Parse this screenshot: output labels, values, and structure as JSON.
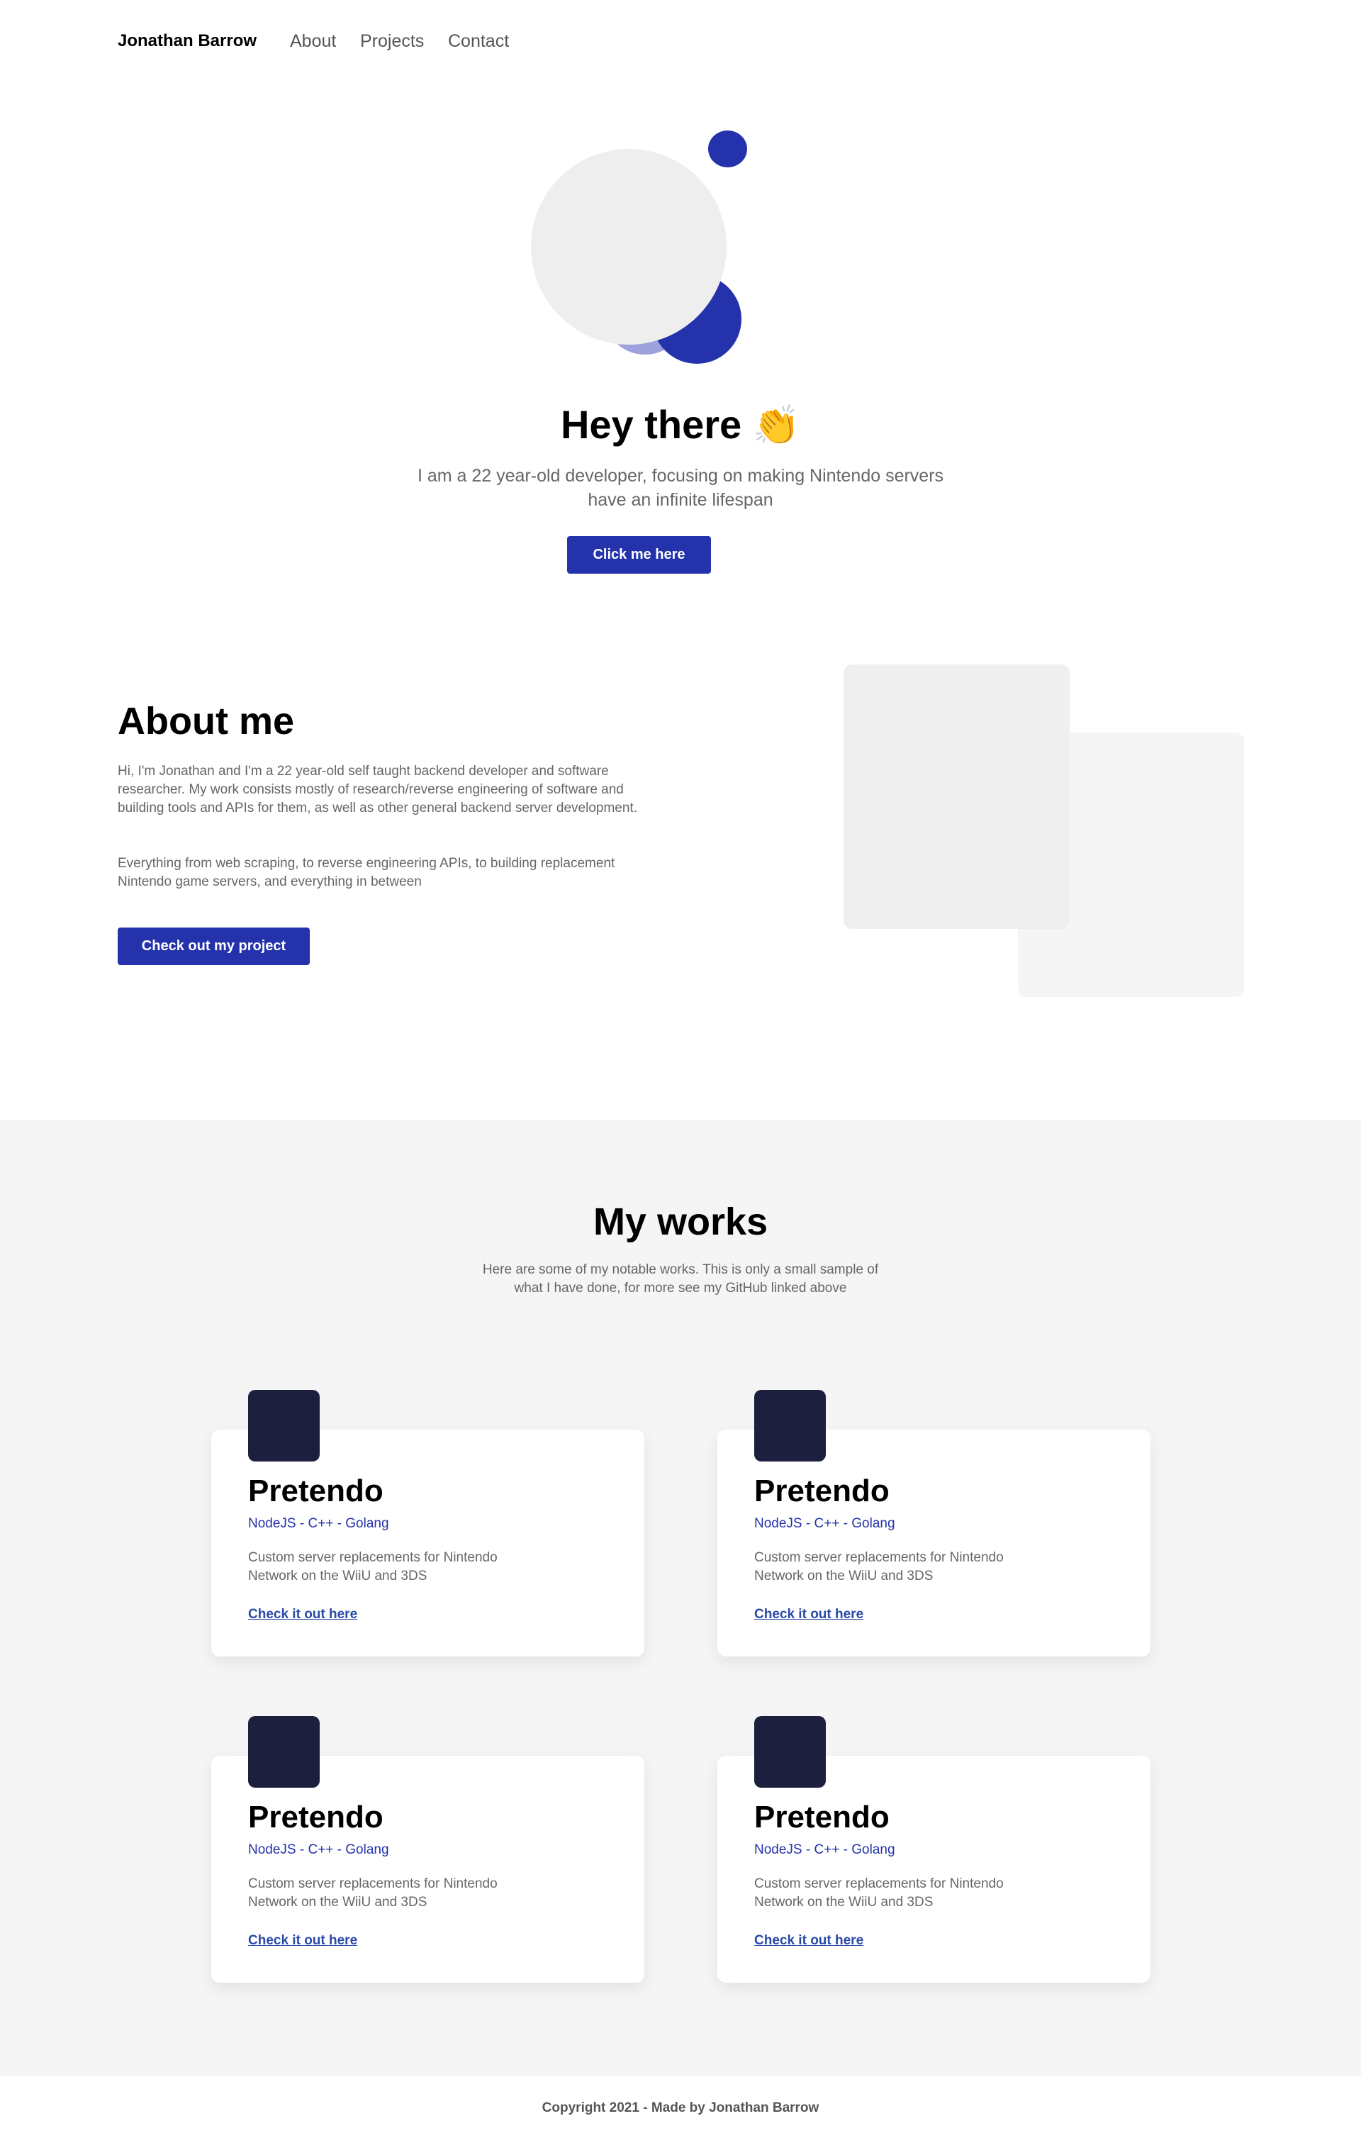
{
  "nav": {
    "brand": "Jonathan Barrow",
    "links": [
      {
        "label": "About"
      },
      {
        "label": "Projects"
      },
      {
        "label": "Contact"
      }
    ]
  },
  "hero": {
    "title": "Hey there",
    "emoji": "👏",
    "subtitle": "I am a 22 year-old developer, focusing on making Nintendo servers have an infinite lifespan",
    "button_label": "Click me here",
    "accent_color": "#2432ac",
    "light_accent_color": "#9da2dc",
    "placeholder_color": "#eeeeee"
  },
  "about": {
    "title": "About me",
    "paragraph1": "Hi, I'm Jonathan and I'm a 22 year-old self taught backend developer and software researcher. My work consists mostly of research/reverse engineering of software and building tools and APIs for them, as well as other general backend server development.",
    "paragraph2": "Everything from web scraping, to reverse engineering APIs, to building replacement Nintendo game servers, and everything in between",
    "button_label": "Check out my project"
  },
  "works": {
    "title": "My works",
    "subtitle": "Here are some of my notable works. This is only a small sample of what I have done, for more see my GitHub linked above",
    "cards": [
      {
        "title": "Pretendo",
        "tags": "NodeJS - C++ - Golang",
        "description": "Custom server replacements for Nintendo Network on the WiiU and 3DS",
        "link_label": "Check it out here"
      },
      {
        "title": "Pretendo",
        "tags": "NodeJS - C++ - Golang",
        "description": "Custom server replacements for Nintendo Network on the WiiU and 3DS",
        "link_label": "Check it out here"
      },
      {
        "title": "Pretendo",
        "tags": "NodeJS - C++ - Golang",
        "description": "Custom server replacements for Nintendo Network on the WiiU and 3DS",
        "link_label": "Check it out here"
      },
      {
        "title": "Pretendo",
        "tags": "NodeJS - C++ - Golang",
        "description": "Custom server replacements for Nintendo Network on the WiiU and 3DS",
        "link_label": "Check it out here"
      }
    ]
  },
  "footer": {
    "text": "Copyright 2021 - Made by Jonathan Barrow"
  }
}
